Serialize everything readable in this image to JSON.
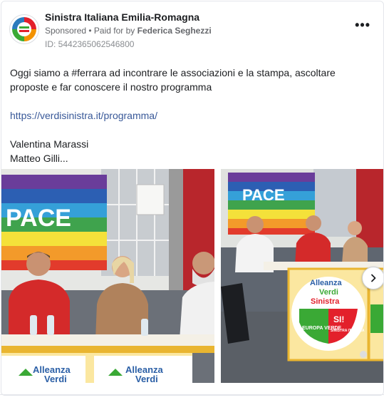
{
  "ad": {
    "page_name": "Sinistra Italiana Emilia-Romagna",
    "sponsored": "Sponsored",
    "paid_for_prefix": "• Paid for by",
    "paid_for_by": "Federica Seghezzi",
    "ad_id": "ID: 5442365062546800",
    "more_label": "•••"
  },
  "post": {
    "line1": "Oggi siamo a #ferrara ad incontrare le associazioni e la stampa, ascoltare proposte e far conoscere il nostro programma",
    "link": "https://verdisinistra.it/programma/",
    "signature1": "Valentina Marassi",
    "signature2": "Matteo Gilli..."
  },
  "photo1": {
    "flag_text": "PACE",
    "banner_text": "Alleanza",
    "banner_text2": "Verdi"
  },
  "photo2": {
    "flag_text": "PACE",
    "sign_alleanza": "Alleanza",
    "sign_verdi": "Verdi",
    "sign_sinistra": "Sinistra",
    "badge_europa": "EUROPA VERDE",
    "badge_si": "SI!",
    "badge_sinistra": "SINISTRA ITALIANA"
  },
  "colors": {
    "link": "#385898",
    "muted": "#65676b",
    "verdi_green": "#3aa935",
    "sinistra_red": "#e3202b"
  },
  "icons": {
    "more": "more-horizontal-icon",
    "next": "chevron-right-icon"
  }
}
